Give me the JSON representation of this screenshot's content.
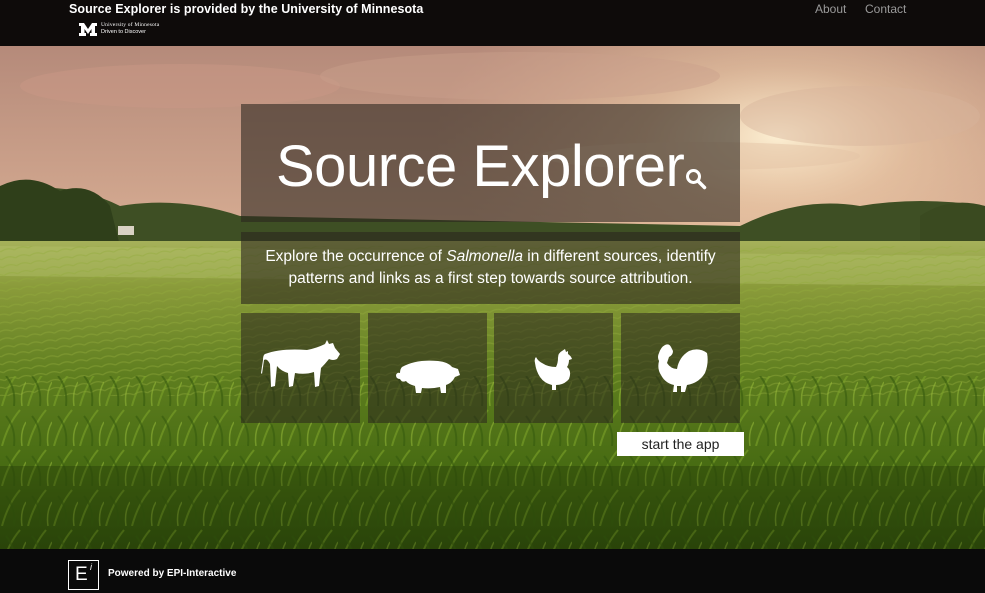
{
  "header": {
    "title": "Source Explorer is provided by the University of Minnesota",
    "university_name": "University of Minnesota",
    "university_tagline": "Driven to Discover",
    "nav": [
      {
        "label": "About"
      },
      {
        "label": "Contact"
      }
    ]
  },
  "hero": {
    "title": "Source Explorer",
    "description_before": "Explore the occurrence of ",
    "description_italic": "Salmonella",
    "description_after": " in different sources, identify patterns and links as a first step towards source attribution.",
    "sources": [
      "cattle-icon",
      "pig-icon",
      "chicken-icon",
      "turkey-icon"
    ],
    "start_button": "start the app"
  },
  "footer": {
    "powered_by": "Powered by EPI-Interactive",
    "logo_letter": "E",
    "logo_superscript": "i"
  },
  "colors": {
    "header_bg": "#0e0b0a",
    "panel_overlay": "rgba(42,36,30,0.58)",
    "nav_text": "#9a9a9a",
    "button_bg": "#ffffff"
  }
}
